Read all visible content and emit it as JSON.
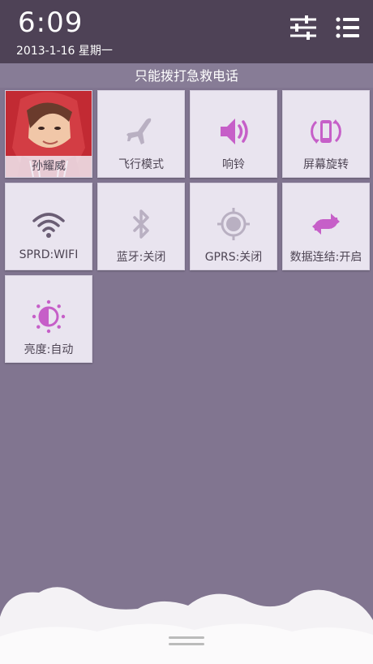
{
  "status": {
    "time": "6:09",
    "date": "2013-1-16  星期一"
  },
  "header": {
    "settings_icon": "sliders-icon",
    "menu_icon": "list-icon"
  },
  "notice": "只能拨打急救电话",
  "tiles": [
    {
      "label": "孙耀威",
      "icon": "avatar-photo"
    },
    {
      "label": "飞行模式",
      "icon": "airplane-icon"
    },
    {
      "label": "响铃",
      "icon": "speaker-icon"
    },
    {
      "label": "屏幕旋转",
      "icon": "rotate-icon"
    },
    {
      "label": "SPRD:WIFI",
      "icon": "wifi-icon"
    },
    {
      "label": "蓝牙:关闭",
      "icon": "bluetooth-icon"
    },
    {
      "label": "GPRS:关闭",
      "icon": "gps-icon"
    },
    {
      "label": "数据连结:开启",
      "icon": "data-sync-icon"
    },
    {
      "label": "亮度:自动",
      "icon": "brightness-icon"
    }
  ],
  "colors": {
    "accent": "#c65fc8",
    "inactive": "#b9b0c2",
    "header_bg": "#4e4256",
    "panel_bg": "#817590"
  }
}
